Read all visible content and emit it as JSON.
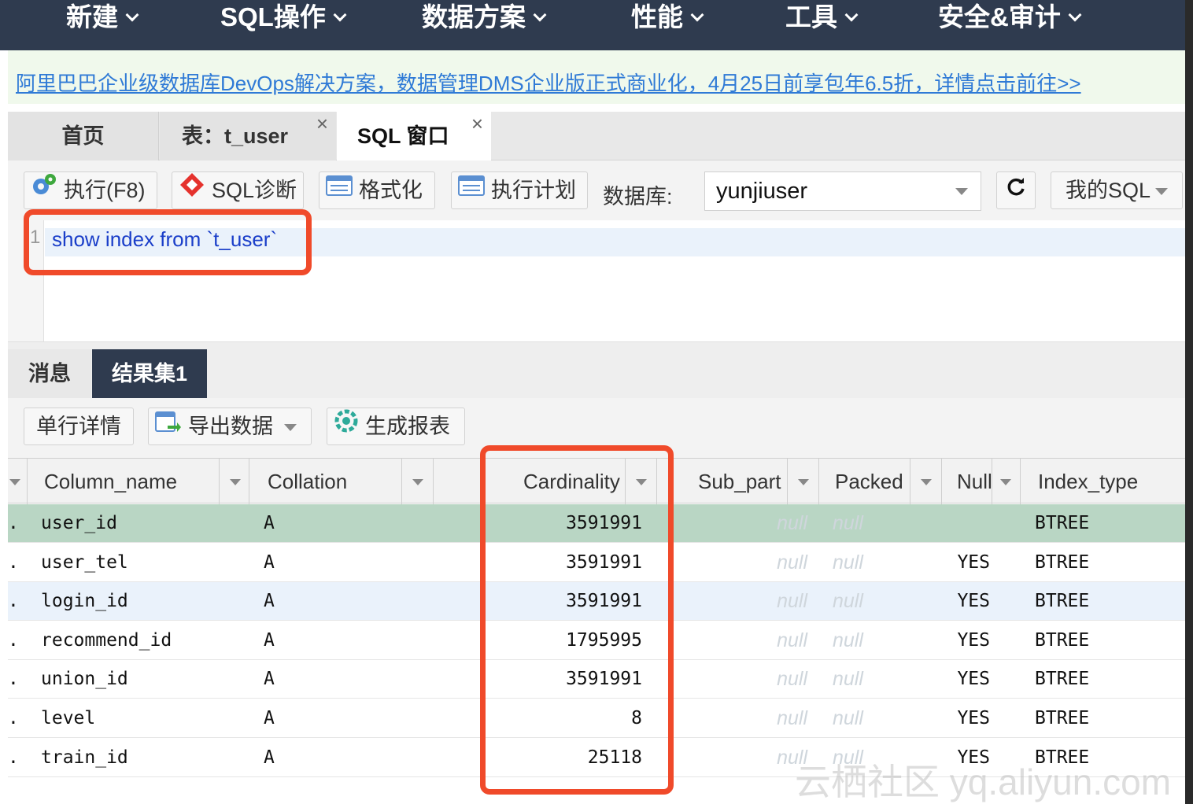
{
  "nav": {
    "items": [
      "新建",
      "SQL操作",
      "数据方案",
      "性能",
      "工具",
      "安全&审计"
    ]
  },
  "banner": {
    "text": "阿里巴巴企业级数据库DevOps解决方案，数据管理DMS企业版正式商业化，4月25日前享包年6.5折，详情点击前往>>"
  },
  "tabs": {
    "home": "首页",
    "table": "表：t_user",
    "sql": "SQL 窗口",
    "close": "×"
  },
  "toolbar": {
    "execute": "执行(F8)",
    "diagnose": "SQL诊断",
    "format": "格式化",
    "plan": "执行计划",
    "db_label": "数据库:",
    "db_value": "yunjiuser",
    "my_sql": "我的SQL"
  },
  "editor": {
    "line_number": "1",
    "code": "show index from `t_user`"
  },
  "result_tabs": {
    "messages": "消息",
    "resultset": "结果集1"
  },
  "result_toolbar": {
    "row_detail": "单行详情",
    "export": "导出数据",
    "report": "生成报表"
  },
  "grid": {
    "columns": [
      "Column_name",
      "Collation",
      "Cardinality",
      "Sub_part",
      "Packed",
      "Null",
      "Index_type"
    ],
    "rows": [
      {
        "column_name": "user_id",
        "collation": "A",
        "cardinality": "3591991",
        "sub_part": "null",
        "packed": "null",
        "null": "",
        "index_type": "BTREE"
      },
      {
        "column_name": "user_tel",
        "collation": "A",
        "cardinality": "3591991",
        "sub_part": "null",
        "packed": "null",
        "null": "YES",
        "index_type": "BTREE"
      },
      {
        "column_name": "login_id",
        "collation": "A",
        "cardinality": "3591991",
        "sub_part": "null",
        "packed": "null",
        "null": "YES",
        "index_type": "BTREE"
      },
      {
        "column_name": "recommend_id",
        "collation": "A",
        "cardinality": "1795995",
        "sub_part": "null",
        "packed": "null",
        "null": "YES",
        "index_type": "BTREE"
      },
      {
        "column_name": "union_id",
        "collation": "A",
        "cardinality": "3591991",
        "sub_part": "null",
        "packed": "null",
        "null": "YES",
        "index_type": "BTREE"
      },
      {
        "column_name": "level",
        "collation": "A",
        "cardinality": "8",
        "sub_part": "null",
        "packed": "null",
        "null": "YES",
        "index_type": "BTREE"
      },
      {
        "column_name": "train_id",
        "collation": "A",
        "cardinality": "25118",
        "sub_part": "null",
        "packed": "null",
        "null": "YES",
        "index_type": "BTREE"
      }
    ],
    "row_marker": "."
  },
  "watermark": "云栖社区 yq.aliyun.com",
  "colors": {
    "nav_bg": "#2f3b4f",
    "highlight_red": "#f04a2a",
    "selected_row": "#b9d6c4",
    "alt_row": "#eaf2fb",
    "link": "#2f7ad6"
  }
}
